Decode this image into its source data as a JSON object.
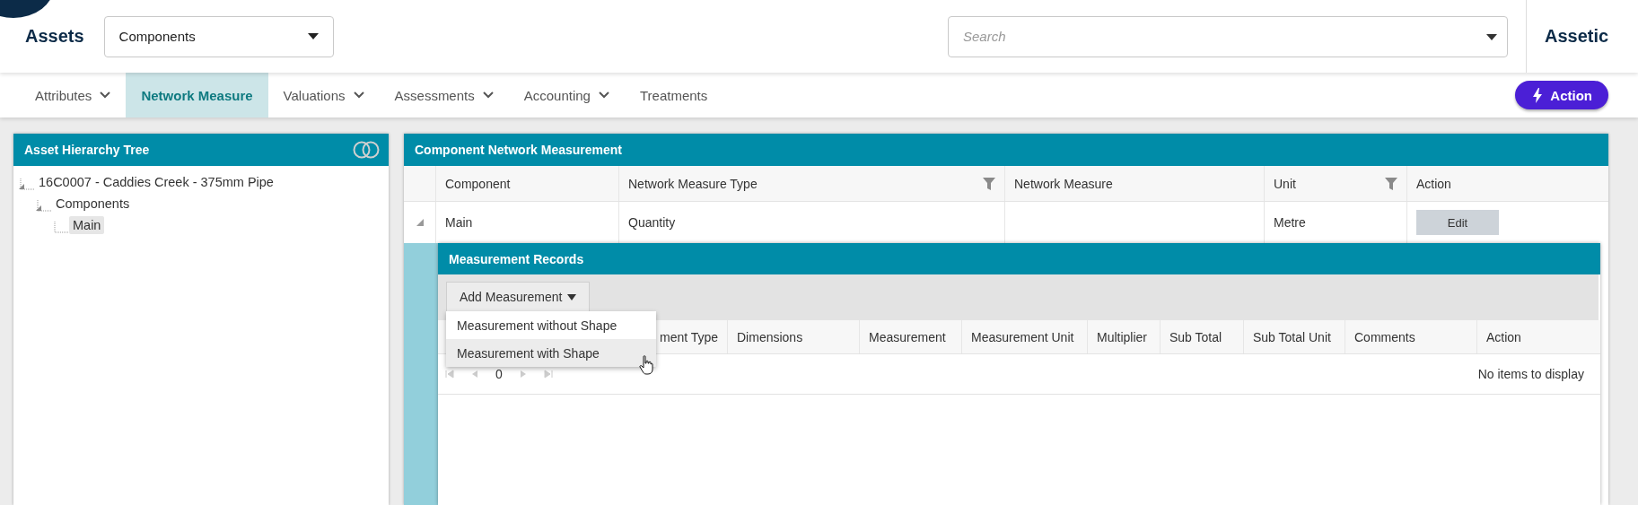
{
  "header": {
    "title": "Assets",
    "category_select": {
      "value": "Components"
    },
    "search": {
      "placeholder": "Search"
    },
    "brand": "Assetic"
  },
  "nav": {
    "tabs": [
      {
        "label": "Attributes",
        "has_menu": true,
        "selected": false
      },
      {
        "label": "Network Measure",
        "has_menu": false,
        "selected": true
      },
      {
        "label": "Valuations",
        "has_menu": true,
        "selected": false
      },
      {
        "label": "Assessments",
        "has_menu": true,
        "selected": false
      },
      {
        "label": "Accounting",
        "has_menu": true,
        "selected": false
      },
      {
        "label": "Treatments",
        "has_menu": false,
        "selected": false
      }
    ],
    "action_button": "Action"
  },
  "tree_panel": {
    "title": "Asset Hierarchy Tree",
    "toggle_on": false,
    "tree": [
      {
        "label": "16C0007 - Caddies Creek - 375mm Pipe",
        "selected": false,
        "children": [
          {
            "label": "Components",
            "selected": false,
            "children": [
              {
                "label": "Main",
                "selected": true
              }
            ]
          }
        ]
      }
    ]
  },
  "network_panel": {
    "title": "Component Network Measurement",
    "columns": [
      {
        "label": "Component",
        "filter": false
      },
      {
        "label": "Network Measure Type",
        "filter": true
      },
      {
        "label": "Network Measure",
        "filter": false
      },
      {
        "label": "Unit",
        "filter": true
      },
      {
        "label": "Action",
        "filter": false
      }
    ],
    "rows": [
      {
        "expanded": true,
        "component": "Main",
        "network_measure_type": "Quantity",
        "unit": "Metre",
        "action": "Edit"
      }
    ]
  },
  "measurement_records": {
    "title": "Measurement Records",
    "add_button": "Add Measurement",
    "menu": [
      {
        "label": "Measurement without Shape",
        "selected": false
      },
      {
        "label": "Measurement with Shape",
        "selected": true
      }
    ],
    "columns": [
      "ment Type",
      "Dimensions",
      "Measurement",
      "Measurement Unit",
      "Multiplier",
      "Sub Total",
      "Sub Total Unit",
      "Comments",
      "Action"
    ],
    "pager": {
      "page": "0"
    },
    "empty_message": "No items to display"
  }
}
